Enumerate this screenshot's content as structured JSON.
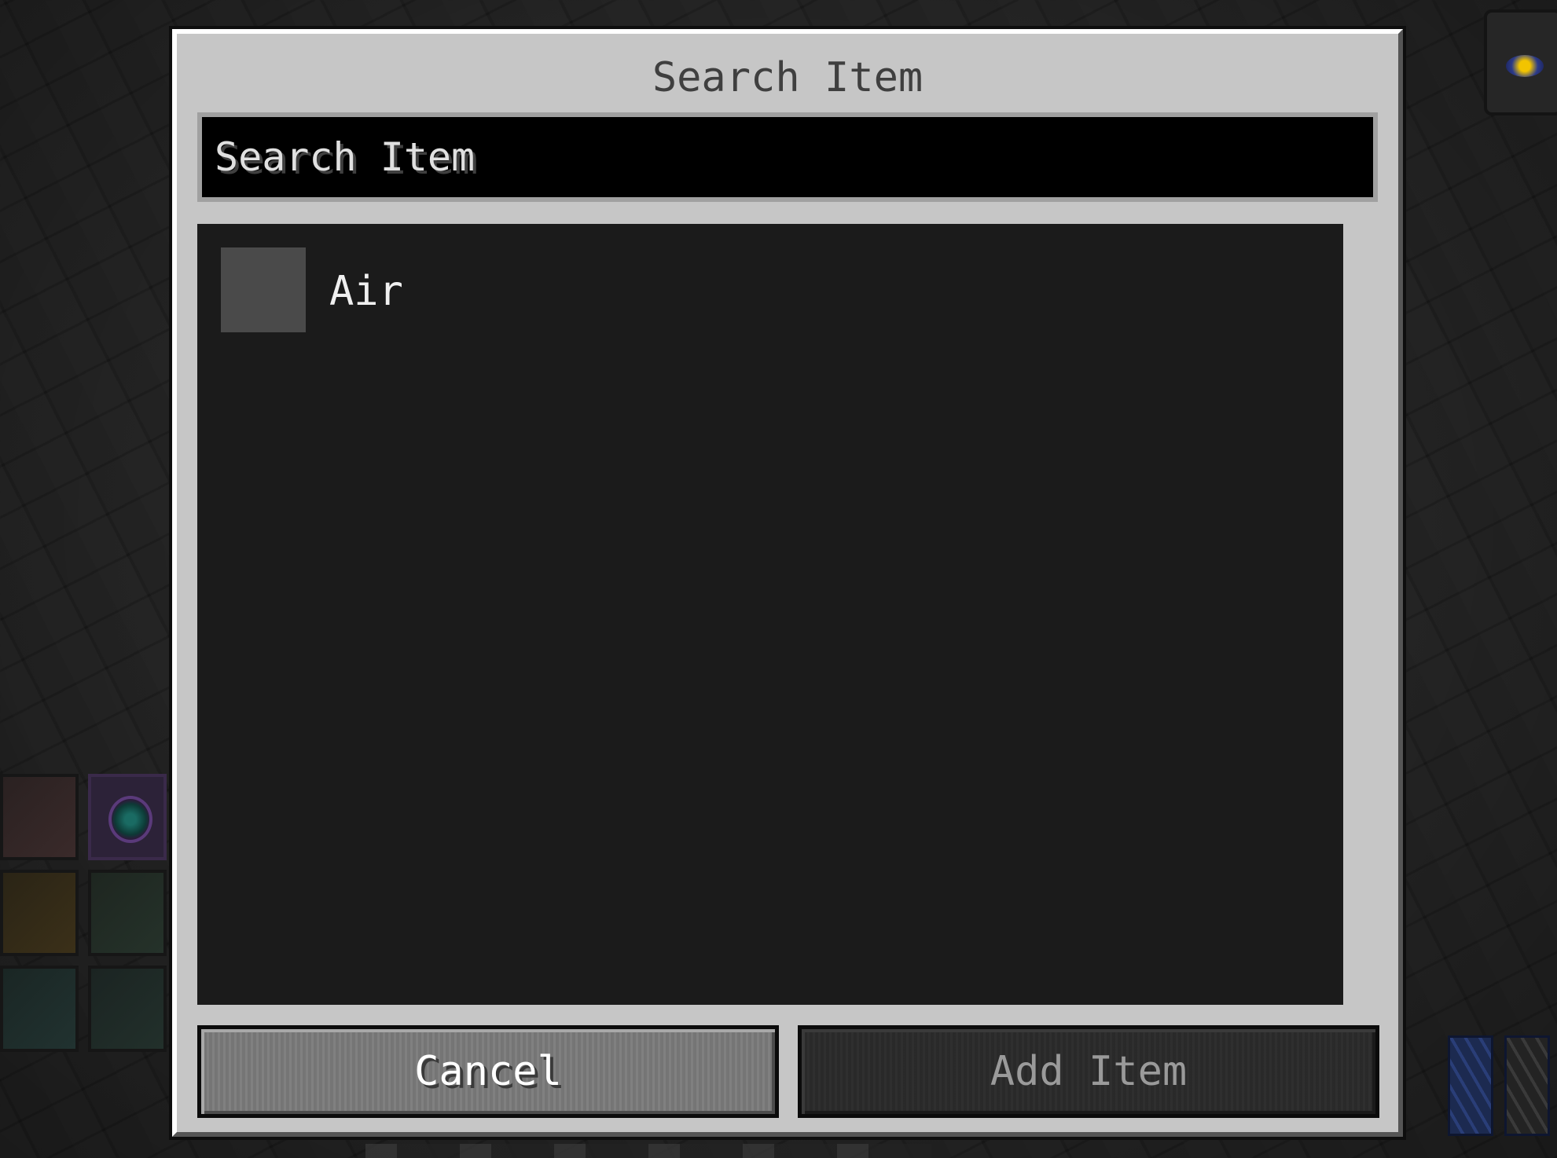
{
  "dialog": {
    "title": "Search Item",
    "search": {
      "placeholder": "Search Item",
      "value": ""
    },
    "results": [
      {
        "label": "Air",
        "icon": "empty-item-icon"
      }
    ],
    "buttons": {
      "cancel_label": "Cancel",
      "add_label": "Add Item"
    }
  },
  "colors": {
    "dialog_bg": "#c6c6c6",
    "results_bg": "#1b1b1b",
    "search_bg": "#000000"
  }
}
